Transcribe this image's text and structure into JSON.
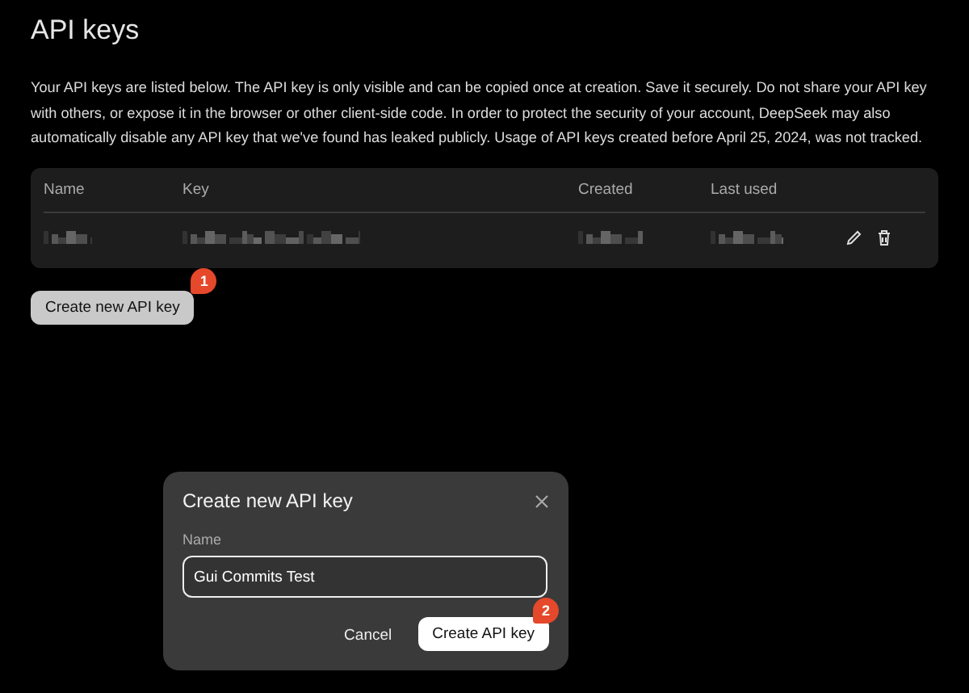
{
  "page": {
    "title": "API keys",
    "description": "Your API keys are listed below. The API key is only visible and can be copied once at creation. Save it securely. Do not share your API key with others, or expose it in the browser or other client-side code. In order to protect the security of your account, DeepSeek may also automatically disable any API key that we've found has leaked publicly. Usage of API keys created before April 25, 2024, was not tracked."
  },
  "table": {
    "columns": [
      "Name",
      "Key",
      "Created",
      "Last used"
    ],
    "rows": [
      {
        "cells": [
          {
            "kind": "redacted"
          },
          {
            "kind": "redacted"
          },
          {
            "kind": "redacted"
          },
          {
            "kind": "redacted"
          }
        ],
        "actions": [
          {
            "kind": "edit"
          },
          {
            "kind": "delete"
          }
        ]
      }
    ]
  },
  "create_button": {
    "label": "Create new API key",
    "badge": "1"
  },
  "dialog": {
    "title": "Create new API key",
    "field_label": "Name",
    "value": "Gui Commits Test",
    "buttons": [
      {
        "label": "Cancel",
        "kind": "secondary"
      },
      {
        "label": "Create API key",
        "kind": "primary",
        "badge": "2"
      }
    ]
  }
}
